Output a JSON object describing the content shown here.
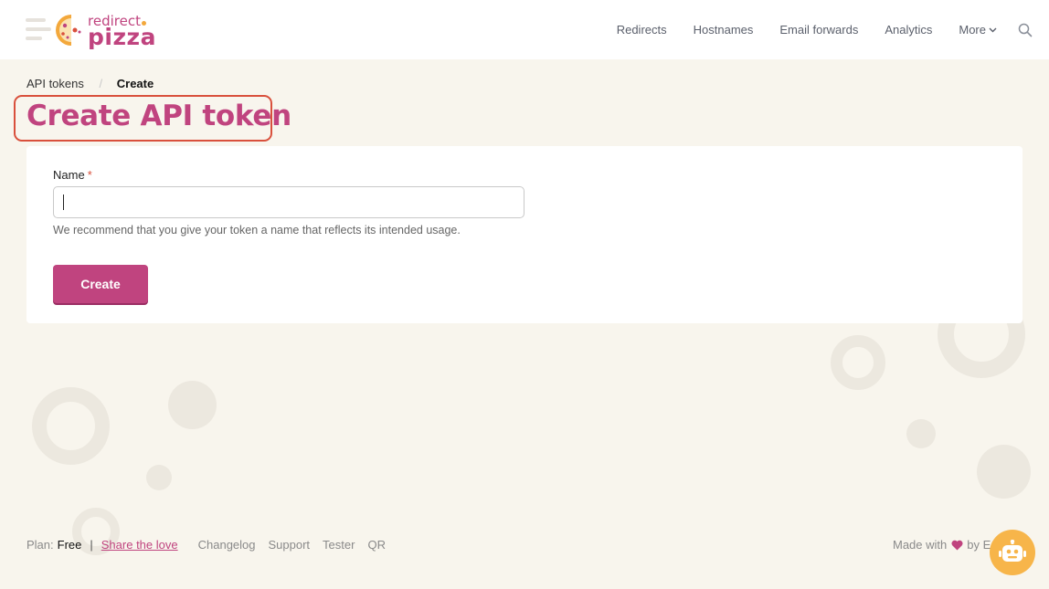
{
  "header": {
    "logo_top": "redirect",
    "logo_bottom": "pizza",
    "nav": {
      "redirects": "Redirects",
      "hostnames": "Hostnames",
      "email_forwards": "Email forwards",
      "analytics": "Analytics",
      "more": "More"
    }
  },
  "breadcrumb": {
    "parent": "API tokens",
    "separator": "/",
    "current": "Create"
  },
  "page_title": "Create API token",
  "form": {
    "name_label": "Name",
    "required_mark": "*",
    "name_value": "",
    "help_text": "We recommend that you give your token a name that reflects its intended usage.",
    "submit_label": "Create"
  },
  "footer": {
    "plan_label": "Plan:",
    "plan_value": "Free",
    "separator": "|",
    "share_link": "Share the love",
    "links": [
      "Changelog",
      "Support",
      "Tester",
      "QR"
    ],
    "made_with": "Made with",
    "by": "by E"
  },
  "colors": {
    "brand": "#c0447f",
    "highlight_border": "#d9503c",
    "background": "#f8f5ed",
    "chat_bot": "#f7b54a"
  },
  "icons": {
    "search": "search-icon",
    "chevron": "chevron-down-icon",
    "heart": "heart-icon",
    "bot": "robot-icon"
  }
}
